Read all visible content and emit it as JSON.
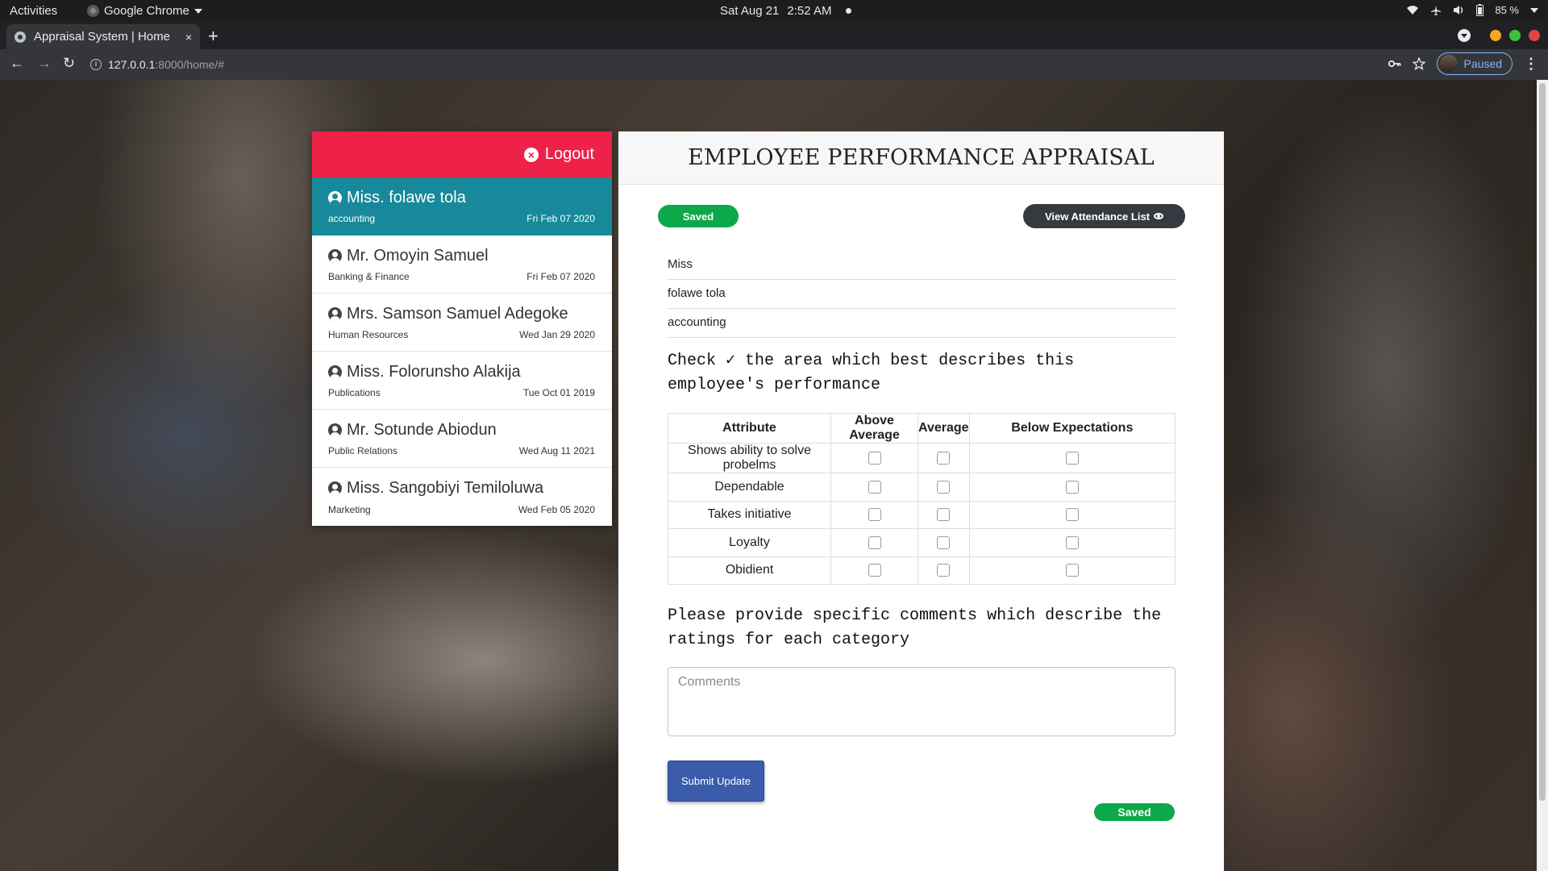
{
  "os": {
    "activities": "Activities",
    "app": "Google Chrome",
    "date": "Sat Aug 21",
    "time": "2:52 AM",
    "battery": "85 %"
  },
  "browser": {
    "tab_title": "Appraisal System | Home",
    "tab_close": "×",
    "new_tab": "+",
    "url_host": "127.0.0.1",
    "url_path": ":8000/home/#",
    "profile_status": "Paused"
  },
  "sidebar": {
    "logout_label": "Logout",
    "employees": [
      {
        "name": "Miss. folawe tola",
        "dept": "accounting",
        "date": "Fri Feb 07 2020",
        "active": true
      },
      {
        "name": "Mr. Omoyin Samuel",
        "dept": "Banking & Finance",
        "date": "Fri Feb 07 2020"
      },
      {
        "name": "Mrs. Samson Samuel Adegoke",
        "dept": "Human Resources",
        "date": "Wed Jan 29 2020"
      },
      {
        "name": "Miss. Folorunsho Alakija",
        "dept": "Publications",
        "date": "Tue Oct 01 2019"
      },
      {
        "name": "Mr. Sotunde Abiodun",
        "dept": "Public Relations",
        "date": "Wed Aug 11 2021"
      },
      {
        "name": "Miss. Sangobiyi Temiloluwa",
        "dept": "Marketing",
        "date": "Wed Feb 05 2020"
      }
    ]
  },
  "main": {
    "title": "EMPLOYEE PERFORMANCE APPRAISAL",
    "saved_label": "Saved",
    "attendance_label": "View Attendance List",
    "fields": {
      "title": "Miss",
      "name": "folawe tola",
      "department": "accounting"
    },
    "instruction_check": "Check ✓ the area which best describes this employee's performance",
    "table": {
      "headers": [
        "Attribute",
        "Above Average",
        "Average",
        "Below Expectations"
      ],
      "rows": [
        "Shows ability to solve probelms",
        "Dependable",
        "Takes initiative",
        "Loyalty",
        "Obidient"
      ]
    },
    "instruction_comments": "Please provide specific comments which describe the ratings for each category",
    "comments_placeholder": "Comments",
    "submit_label": "Submit Update",
    "saved_bottom_label": "Saved"
  },
  "colors": {
    "logout_red": "#ee2148",
    "active_teal": "#17899a",
    "saved_green": "#0da84a",
    "dark_button": "#343a40",
    "submit_blue": "#3b5bab"
  }
}
